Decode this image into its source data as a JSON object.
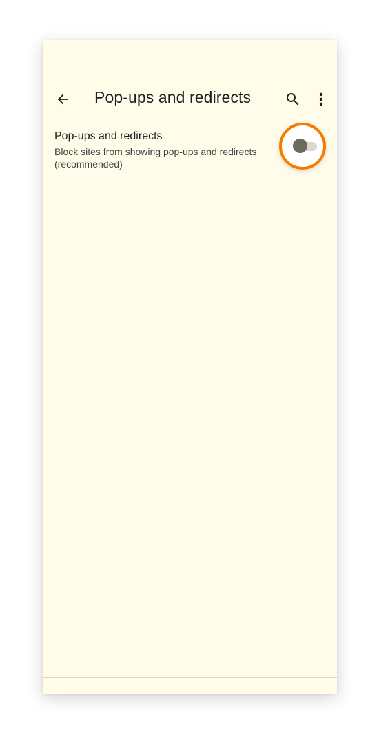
{
  "toolbar": {
    "title": "Pop-ups and redirects",
    "back_icon": "arrow-back-icon",
    "search_icon": "search-icon",
    "more_icon": "more-vert-icon"
  },
  "setting": {
    "title": "Pop-ups and redirects",
    "summary": "Block sites from showing pop-ups and redirects (recommended)",
    "toggle_state": "off"
  },
  "colors": {
    "background": "#fffcea",
    "highlight": "#f57c00",
    "toggle_thumb": "#6b6b5b",
    "toggle_track": "#d9d9d0"
  }
}
